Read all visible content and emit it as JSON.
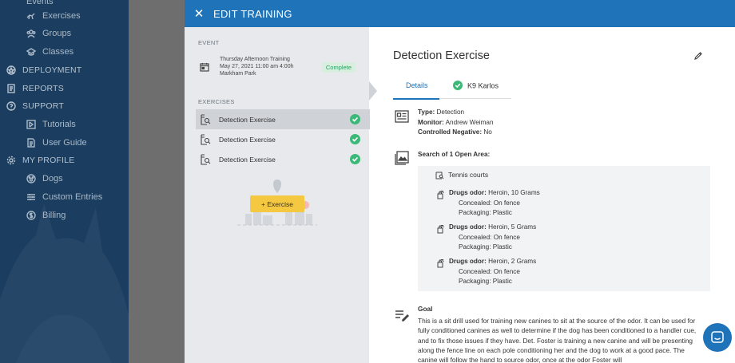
{
  "nav": {
    "top_partial": "Events",
    "exercises": "Exercises",
    "groups": "Groups",
    "classes": "Classes",
    "deployment": "DEPLOYMENT",
    "reports": "REPORTS",
    "support": "SUPPORT",
    "tutorials": "Tutorials",
    "user_guide": "User Guide",
    "my_profile": "MY PROFILE",
    "dogs": "Dogs",
    "custom_entries": "Custom Entries",
    "billing": "Billing"
  },
  "dialog": {
    "title": "EDIT TRAINING",
    "event_label": "EVENT",
    "event": {
      "name": "Thursday Afternoon Training",
      "datetime": "May 27, 2021 11:00 am 4:00h",
      "location": "Markham Park",
      "status": "Complete"
    },
    "exercises_label": "EXERCISES",
    "exercises": [
      "Detection Exercise",
      "Detection Exercise",
      "Detection Exercise"
    ],
    "add_exercise": "+ Exercise"
  },
  "detail": {
    "heading": "Detection Exercise",
    "tab_details": "Details",
    "tab_k9": "K9 Karlos",
    "type_label": "Type:",
    "type_value": "Detection",
    "monitor_label": "Monitor:",
    "monitor_value": "Andrew Weiman",
    "negative_label": "Controlled Negative:",
    "negative_value": "No",
    "search_title": "Search of 1 Open Area:",
    "area_name": "Tennis courts",
    "odors": [
      {
        "label": "Drugs odor:",
        "value": "Heroin, 10 Grams",
        "concealed": "Concealed: On fence",
        "packaging": "Packaging: Plastic"
      },
      {
        "label": "Drugs odor:",
        "value": "Heroin, 5 Grams",
        "concealed": "Concealed: On fence",
        "packaging": "Packaging: Plastic"
      },
      {
        "label": "Drugs odor:",
        "value": "Heroin, 2 Grams",
        "concealed": "Concealed: On fence",
        "packaging": "Packaging: Plastic"
      }
    ],
    "goal_title": "Goal",
    "goal_text": "This is a sit drill used for training new canines to sit at the source of the odor.  It can be used for fully conditioned canines as well to determine if the dog has been conditioned to a handler cue, and to fix those issues if they have.  Det. Foster is training a new canine and will be presenting along the fence line on each pole conditioning her and the dog to work at a good pace.  The canine will follow the hand to source odor, once at the odor Foster will"
  },
  "colors": {
    "header_blue": "#1f73b8",
    "sidebar_navy": "#1b3d5f",
    "success_green": "#3cb878",
    "add_button_yellow": "#f5c842"
  }
}
